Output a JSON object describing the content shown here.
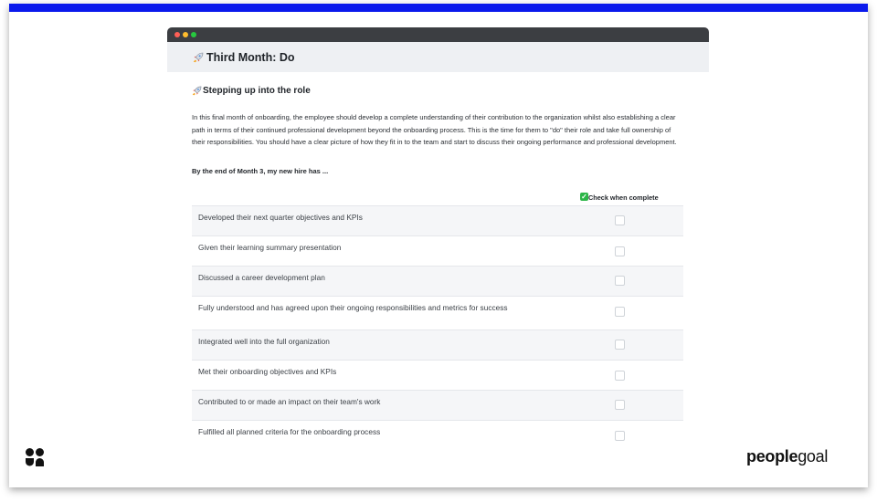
{
  "window": {
    "title": "Third Month: Do",
    "section_heading": "Stepping up into the role",
    "intro": "In this final month of onboarding, the employee should develop a complete understanding of their contribution to the organization whilst also establishing a clear path in terms of their continued professional development beyond the onboarding process. This is the time for them to \"do\" their role and take full ownership of their responsibilities. You should have a clear picture of how they fit in to the team and start to discuss their ongoing performance and professional development.",
    "subheading": "By the end of Month 3, my new hire has ...",
    "check_column_label": "Check when complete",
    "items": [
      {
        "label": "Developed their next quarter objectives and KPIs",
        "checked": false
      },
      {
        "label": "Given their learning summary presentation",
        "checked": false
      },
      {
        "label": "Discussed a career development plan",
        "checked": false
      },
      {
        "label": "Fully understood and has agreed upon their ongoing responsibilities and metrics for success",
        "checked": false
      },
      {
        "label": "Integrated well into the full organization",
        "checked": false
      },
      {
        "label": "Met their onboarding objectives and KPIs",
        "checked": false
      },
      {
        "label": "Contributed to or made an impact on their team's work",
        "checked": false
      },
      {
        "label": "Fulfilled all planned criteria for the onboarding process",
        "checked": false
      }
    ]
  },
  "brand": {
    "logo_bold": "people",
    "logo_light": "goal",
    "accent_color": "#0a19ec",
    "check_color": "#2cb548"
  }
}
